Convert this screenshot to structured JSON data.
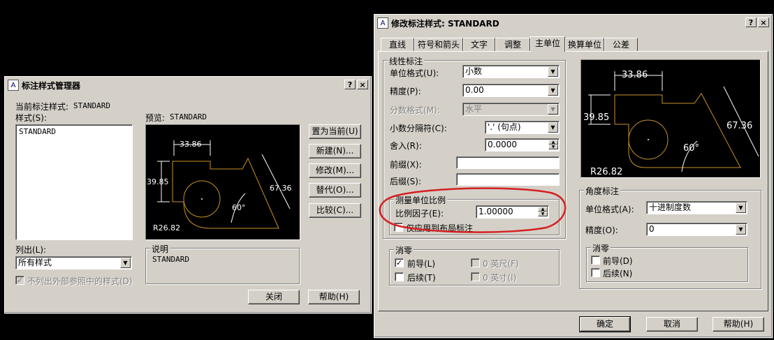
{
  "manager": {
    "title": "标注样式管理器",
    "current_style_label": "当前标注样式:",
    "current_style_value": "STANDARD",
    "styles_label": "样式(S):",
    "styles": [
      "STANDARD"
    ],
    "preview_label": "预览:",
    "preview_value": "STANDARD",
    "buttons": {
      "set_current": "置为当前(U)",
      "new": "新建(N)...",
      "modify": "修改(M)...",
      "override": "替代(O)...",
      "compare": "比较(C)...",
      "close": "关闭",
      "help": "帮助(H)"
    },
    "list_label": "列出(L):",
    "list_value": "所有样式",
    "xref_checkbox": "不列出外部参照中的样式(D)",
    "description_label": "说明",
    "description_value": "STANDARD",
    "help_btn": "?",
    "close_btn": "×"
  },
  "modify": {
    "title": "修改标注样式: STANDARD",
    "tabs": [
      "直线",
      "符号和箭头",
      "文字",
      "调整",
      "主单位",
      "换算单位",
      "公差"
    ],
    "active_tab": "主单位",
    "linear": {
      "title": "线性标注",
      "unit_format_label": "单位格式(U):",
      "unit_format_value": "小数",
      "precision_label": "精度(P):",
      "precision_value": "0.00",
      "fraction_label": "分数格式(M):",
      "fraction_value": "水平",
      "decimal_sep_label": "小数分隔符(C):",
      "decimal_sep_value": "'.' (句点)",
      "round_label": "舍入(R):",
      "round_value": "0.0000",
      "prefix_label": "前缀(X):",
      "prefix_value": "",
      "suffix_label": "后缀(S):",
      "suffix_value": ""
    },
    "scale": {
      "title": "测量单位比例",
      "factor_label": "比例因子(E):",
      "factor_value": "1.00000",
      "layout_only": "仅应用到布局标注"
    },
    "zero": {
      "title": "消零",
      "leading": "前导(L)",
      "trailing": "后续(T)",
      "feet": "0 英尺(F)",
      "inches": "0 英寸(I)"
    },
    "angular": {
      "title": "角度标注",
      "unit_format_label": "单位格式(A):",
      "unit_format_value": "十进制度数",
      "precision_label": "精度(O):",
      "precision_value": "0",
      "zero_title": "消零",
      "leading": "前导(D)",
      "trailing": "后续(N)"
    },
    "buttons": {
      "ok": "确定",
      "cancel": "取消",
      "help": "帮助(H)"
    },
    "help_btn": "?",
    "close_btn": "×"
  },
  "preview_dims": {
    "top": "33.86",
    "left": "39.85",
    "right": "67.36",
    "angle": "60°",
    "radius": "R26.82"
  },
  "colors": {
    "dim_line": "#ffffff",
    "geometry": "#c8922a",
    "highlight": "#d42020",
    "face": "#d4d0c8"
  }
}
